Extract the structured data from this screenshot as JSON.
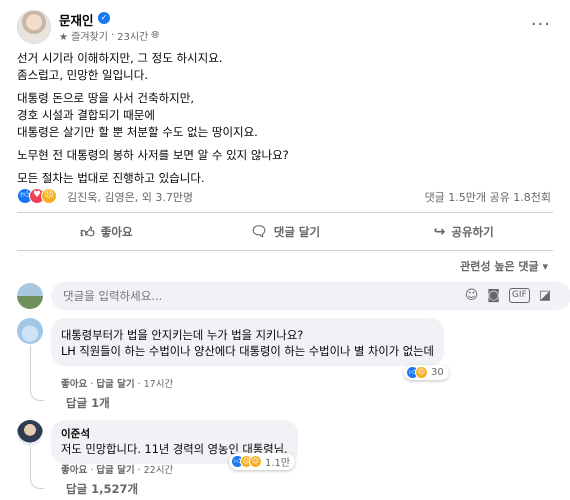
{
  "post": {
    "author": "문재인",
    "verified_glyph": "✓",
    "favorites_label": "★ 즐겨찾기",
    "time": "23시간",
    "more_glyph": "···",
    "paragraphs": [
      [
        "선거 시기라 이해하지만, 그 정도 하시지요.",
        "좀스럽고, 민망한 일입니다."
      ],
      [
        "대통령 돈으로 땅을 사서 건축하지만,",
        "경호 시설과 결합되기 때문에",
        "대통령은 살기만 할 뿐 처분할 수도 없는 땅이지요."
      ],
      [
        "노무현 전 대통령의 봉하 사저를 보면 알 수 있지 않나요?"
      ],
      [
        "모든 절차는 법대로 진행하고 있습니다."
      ]
    ],
    "reactors": "김진욱, 김영은, 외 3.7만명",
    "counts": "댓글 1.5만개  공유 1.8천회"
  },
  "actions": {
    "like": "좋아요",
    "comment": "댓글 달기",
    "share": "공유하기"
  },
  "sort_label": "관련성 높은 댓글 ▾",
  "comment_input": {
    "placeholder": "댓글을 입력하세요..."
  },
  "comments": [
    {
      "name": "",
      "lines": [
        "대통령부터가 법을 안지키는데 누가 법을 지키나요?",
        "LH 직원들이 하는 수법이나 양산에다 대통령이 하는 수법이나 별 차이가 없는데"
      ],
      "like": "좋아요",
      "reply": "답글 달기",
      "time": "17시간",
      "reaction_count": "30",
      "replies": "답글 1개"
    },
    {
      "name": "이준석",
      "lines": [
        "저도 민망합니다. 11년 경력의 영농인 대통령님."
      ],
      "like": "좋아요",
      "reply": "답글 달기",
      "time": "22시간",
      "reaction_count": "1.1만",
      "replies": "답글 1,527개"
    }
  ],
  "colors": {
    "brand_blue": "#1877f2",
    "love_red": "#f33e58",
    "sad_yellow": "#f7b125",
    "secondary_text": "#65676b",
    "bubble_bg": "#f0f2f5"
  },
  "icons": [
    "verified-icon",
    "star-icon",
    "more-icon",
    "like-reaction-icon",
    "love-reaction-icon",
    "sad-reaction-icon",
    "thumbs-up-icon",
    "comment-icon",
    "share-icon",
    "emoji-icon",
    "camera-icon",
    "gif-icon",
    "sticker-icon",
    "reply-arrow-icon"
  ]
}
